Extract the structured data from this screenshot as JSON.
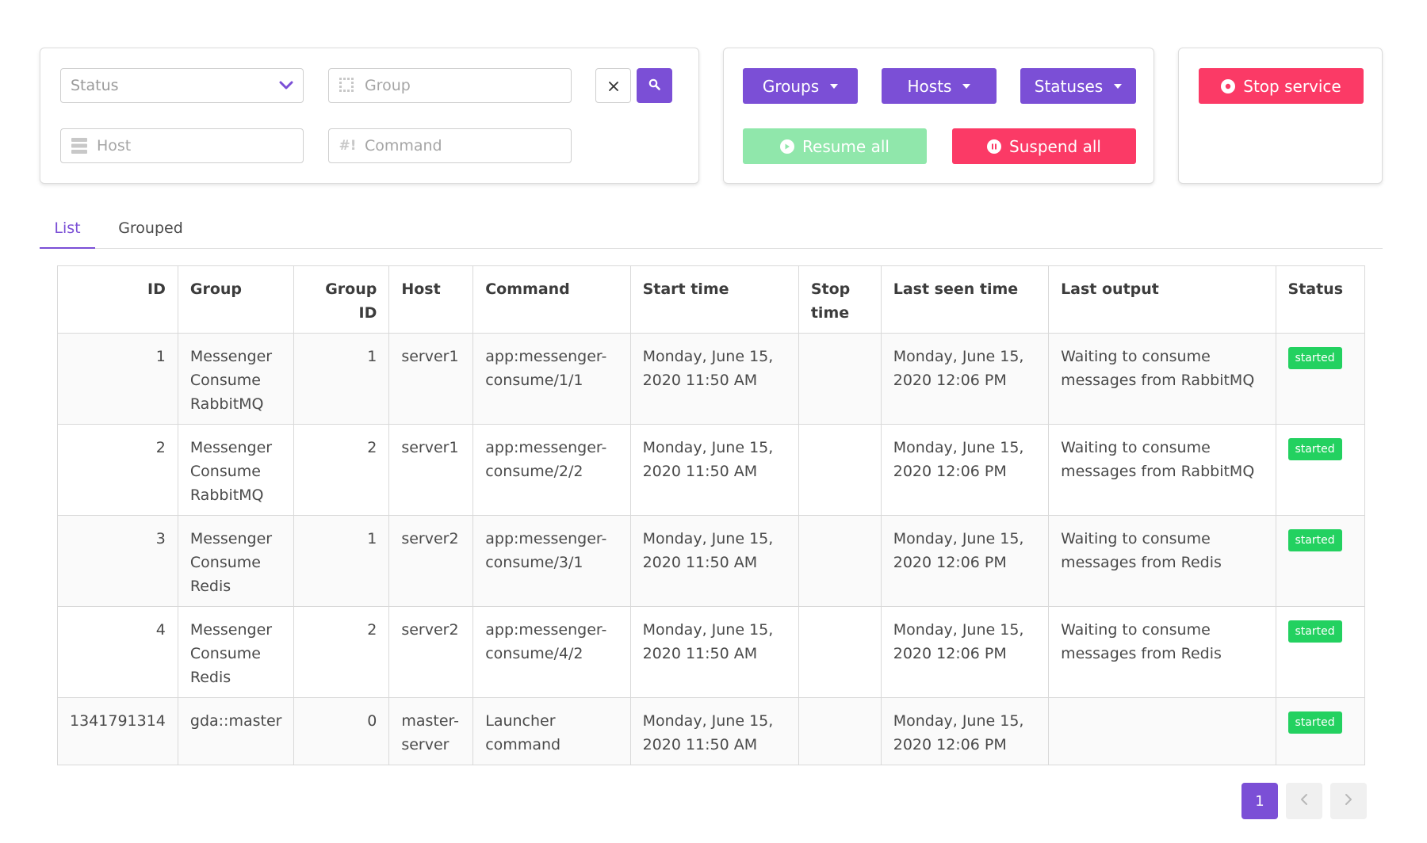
{
  "filters": {
    "status_placeholder": "Status",
    "group_placeholder": "Group",
    "host_placeholder": "Host",
    "command_placeholder": "Command",
    "command_icon_text": "#!"
  },
  "actions": {
    "groups_label": "Groups",
    "hosts_label": "Hosts",
    "statuses_label": "Statuses",
    "resume_all_label": "Resume all",
    "suspend_all_label": "Suspend all"
  },
  "service": {
    "stop_label": "Stop service"
  },
  "tabs": [
    {
      "label": "List"
    },
    {
      "label": "Grouped"
    }
  ],
  "table": {
    "headers": {
      "id": "ID",
      "group": "Group",
      "group_id_1": "Group",
      "group_id_2": "ID",
      "host": "Host",
      "command": "Command",
      "start_time": "Start time",
      "stop_time_1": "Stop",
      "stop_time_2": "time",
      "last_seen": "Last seen time",
      "last_output": "Last output",
      "status": "Status"
    },
    "rows": [
      {
        "id": "1",
        "group": [
          "Messenger",
          "Consume",
          "RabbitMQ"
        ],
        "group_id": "1",
        "host": [
          "server1"
        ],
        "command": [
          "app:messenger-",
          "consume/1/1"
        ],
        "start": [
          "Monday, June 15,",
          "2020 11:50 AM"
        ],
        "stop": "",
        "last_seen": [
          "Monday, June 15,",
          "2020 12:06 PM"
        ],
        "output": [
          "Waiting to consume",
          "messages from RabbitMQ"
        ],
        "status": "started"
      },
      {
        "id": "2",
        "group": [
          "Messenger",
          "Consume",
          "RabbitMQ"
        ],
        "group_id": "2",
        "host": [
          "server1"
        ],
        "command": [
          "app:messenger-",
          "consume/2/2"
        ],
        "start": [
          "Monday, June 15,",
          "2020 11:50 AM"
        ],
        "stop": "",
        "last_seen": [
          "Monday, June 15,",
          "2020 12:06 PM"
        ],
        "output": [
          "Waiting to consume",
          "messages from RabbitMQ"
        ],
        "status": "started"
      },
      {
        "id": "3",
        "group": [
          "Messenger",
          "Consume",
          "Redis"
        ],
        "group_id": "1",
        "host": [
          "server2"
        ],
        "command": [
          "app:messenger-",
          "consume/3/1"
        ],
        "start": [
          "Monday, June 15,",
          "2020 11:50 AM"
        ],
        "stop": "",
        "last_seen": [
          "Monday, June 15,",
          "2020 12:06 PM"
        ],
        "output": [
          "Waiting to consume",
          "messages from Redis"
        ],
        "status": "started"
      },
      {
        "id": "4",
        "group": [
          "Messenger",
          "Consume",
          "Redis"
        ],
        "group_id": "2",
        "host": [
          "server2"
        ],
        "command": [
          "app:messenger-",
          "consume/4/2"
        ],
        "start": [
          "Monday, June 15,",
          "2020 11:50 AM"
        ],
        "stop": "",
        "last_seen": [
          "Monday, June 15,",
          "2020 12:06 PM"
        ],
        "output": [
          "Waiting to consume",
          "messages from Redis"
        ],
        "status": "started"
      },
      {
        "id": "1341791314",
        "group": [
          "gda::master"
        ],
        "group_id": "0",
        "host": [
          "master-",
          "server"
        ],
        "command": [
          "Launcher",
          "command"
        ],
        "start": [
          "Monday, June 15,",
          "2020 11:50 AM"
        ],
        "stop": "",
        "last_seen": [
          "Monday, June 15,",
          "2020 12:06 PM"
        ],
        "output": [],
        "status": "started"
      }
    ]
  },
  "pagination": {
    "current_page": "1",
    "prev_icon": "‹",
    "next_icon": "›"
  },
  "colors": {
    "accent": "#7b4fd6",
    "danger": "#fb3a66",
    "success": "#23d160",
    "success_light": "#90e7ab"
  }
}
